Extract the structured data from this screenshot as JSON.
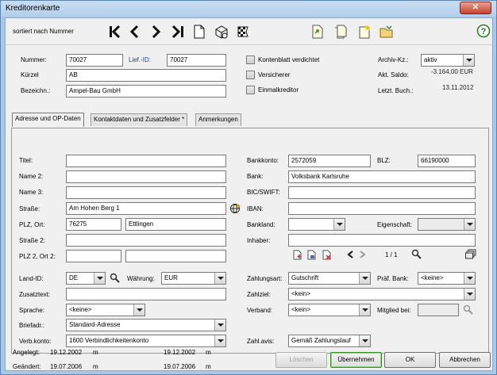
{
  "window": {
    "title": "Kreditorenkarte",
    "close_glyph": "✕"
  },
  "toolbar": {
    "sort_label": "sortiert nach Nummer",
    "nav_icons": [
      "first-record-icon",
      "previous-record-icon",
      "next-record-icon",
      "last-record-icon",
      "new-document-icon",
      "package-icon",
      "checkered-flag-icon"
    ],
    "right_icons": [
      "document-export-icon",
      "document-copy-icon",
      "document-new-icon",
      "folder-open-icon"
    ],
    "help_glyph": "?"
  },
  "header": {
    "nummer_label": "Nummer:",
    "nummer_value": "70027",
    "lief_id_label": "Lief.-ID:",
    "lief_id_value": "70027",
    "kuerzel_label": "Kürzel",
    "kuerzel_value": "AB",
    "bezeichn_label": "Bezeichn.:",
    "bezeichn_value": "Ampel-Bau GmbH",
    "checkboxes": [
      {
        "label": "Kontenblatt verdichtet",
        "checked": false
      },
      {
        "label": "Versicherer",
        "checked": false
      },
      {
        "label": "Einmalkreditor",
        "checked": false
      }
    ],
    "archiv_label": "Archiv-Kz.:",
    "archiv_value": "aktiv",
    "saldo_label": "Akt. Saldo:",
    "saldo_value": "-3.164,00 EUR",
    "buchung_label": "Letzt. Buch.:",
    "buchung_value": "13.11.2012"
  },
  "tabs": [
    {
      "label": "Adresse und OP-Daten",
      "active": true
    },
    {
      "label": "Kontaktdaten und Zusatzfelder *",
      "active": false
    },
    {
      "label": "Anmerkungen",
      "active": false
    }
  ],
  "address": {
    "titel_label": "Titel:",
    "titel_value": "",
    "name2_label": "Name 2:",
    "name2_value": "",
    "name3_label": "Name 3:",
    "name3_value": "",
    "strasse_label": "Straße:",
    "strasse_value": "Am Hohen Berg 1",
    "plz_ort_label": "PLZ, Ort:",
    "plz_value": "76275",
    "ort_value": "Ettlingen",
    "strasse2_label": "Straße 2:",
    "strasse2_value": "",
    "plz2_ort2_label": "PLZ 2, Ort 2:",
    "plz2_value": "",
    "ort2_value": ""
  },
  "bank": {
    "bankkonto_label": "Bankkonto:",
    "bankkonto_value": "2572059",
    "blz_label": "BLZ:",
    "blz_value": "66190000",
    "bank_label": "Bank:",
    "bank_value": "Volksbank Karlsruhe",
    "bic_label": "BIC/SWIFT:",
    "bic_value": "",
    "iban_label": "IBAN:",
    "iban_value": "",
    "bankland_label": "Bankland:",
    "bankland_value": "",
    "eigenschaft_label": "Eigenschaft:",
    "eigenschaft_value": "",
    "inhaber_label": "Inhaber:",
    "inhaber_value": "",
    "pager": "1 / 1"
  },
  "lower": {
    "land_id_label": "Land-ID:",
    "land_id_value": "DE",
    "waehrung_label": "Währung:",
    "waehrung_value": "EUR",
    "zusatztext_label": "Zusatztext:",
    "zusatztext_value": "",
    "sprache_label": "Sprache:",
    "sprache_value": "<keine>",
    "briefadr_label": "Briefadr.:",
    "briefadr_value": "Standard-Adresse",
    "verbkonto_label": "Verb.konto:",
    "verbkonto_value": "1600 Verbindlichkeitenkonto",
    "zahlungsart_label": "Zahlungsart:",
    "zahlungsart_value": "Gutschrift",
    "praef_bank_label": "Präf. Bank:",
    "praef_bank_value": "<keine>",
    "zahlziel_label": "Zahlziel:",
    "zahlziel_value": "<kein>",
    "verband_label": "Verband:",
    "verband_value": "<kein>",
    "mitglied_label": "Mitglied bei:",
    "mitglied_value": "",
    "zahlavis_label": "Zahl.avis:",
    "zahlavis_value": "Gemäß Zahlungslauf"
  },
  "footer": {
    "angelegt_label": "Angelegt:",
    "angelegt_date1": "19.12.2002",
    "angelegt_user1": "m",
    "angelegt_date2": "19.12.2002",
    "angelegt_user2": "m",
    "geaendert_label": "Geändert:",
    "geaendert_date1": "19.07.2006",
    "geaendert_user1": "m",
    "geaendert_date2": "19.07.2006",
    "geaendert_user2": "m",
    "loeschen_label": "Löschen",
    "uebernehmen_label": "Übernehmen",
    "ok_label": "OK",
    "abbrechen_label": "Abbrechen"
  },
  "colors": {
    "label_blue": "#1a3f9e",
    "title_bg": "#b4cfec",
    "close_red": "#c7432e",
    "default_button_green": "#3c8f2a"
  }
}
